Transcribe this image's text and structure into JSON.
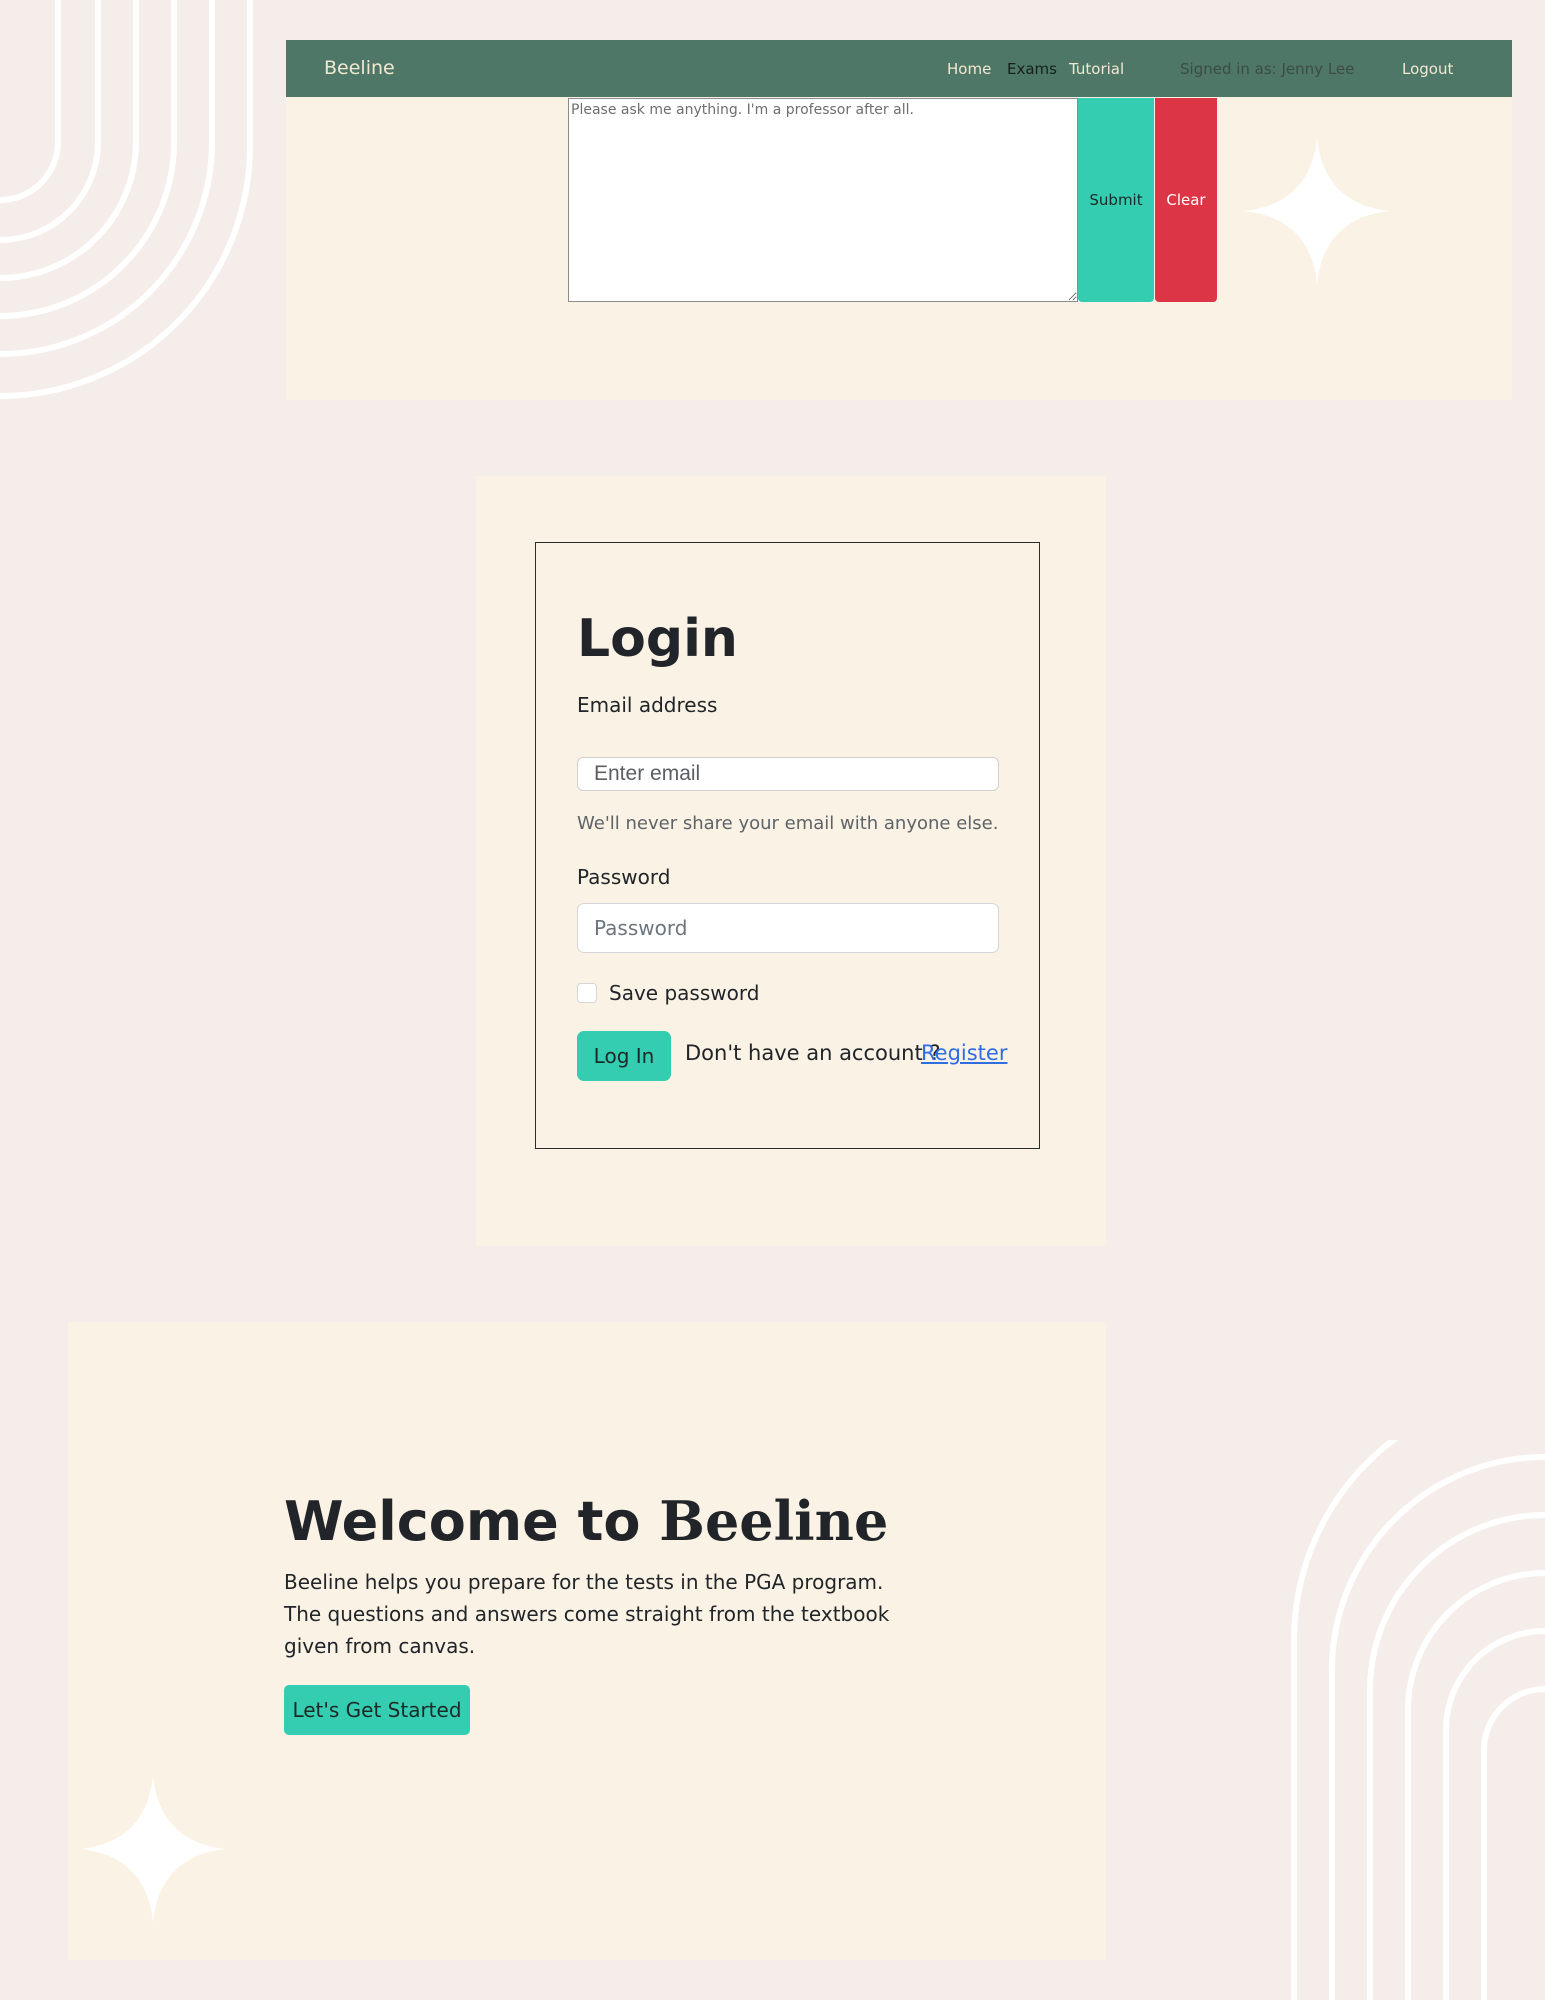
{
  "navbar": {
    "brand": "Beeline",
    "links": [
      {
        "label": "Home"
      },
      {
        "label": "Exams"
      },
      {
        "label": "Tutorial"
      }
    ],
    "signed_in_text": "Signed in as: Jenny Lee",
    "logout_label": "Logout"
  },
  "question": {
    "placeholder": "Please ask me anything. I'm a professor after all.",
    "submit_label": "Submit",
    "clear_label": "Clear"
  },
  "login": {
    "title": "Login",
    "email_label": "Email address",
    "email_placeholder": "Enter email",
    "email_help": "We'll never share your email with anyone else.",
    "password_label": "Password",
    "password_placeholder": "Password",
    "save_password_label": "Save password",
    "login_button": "Log In",
    "no_account_text": "Don't have an account ?",
    "register_link": "Register"
  },
  "welcome": {
    "title_prefix": "Welcome to ",
    "title_brand": "Beeline",
    "text": "Beeline helps you prepare for the tests in the PGA program. The questions and answers come straight from the textbook given from canvas.",
    "button_label": "Let's Get Started"
  },
  "colors": {
    "page_background": "#f5ede9",
    "panel_background": "#faf2e4",
    "navbar": "#4e7768",
    "accent_teal": "#35cdb2",
    "danger_red": "#dc3545",
    "link_blue": "#2f6de0"
  }
}
